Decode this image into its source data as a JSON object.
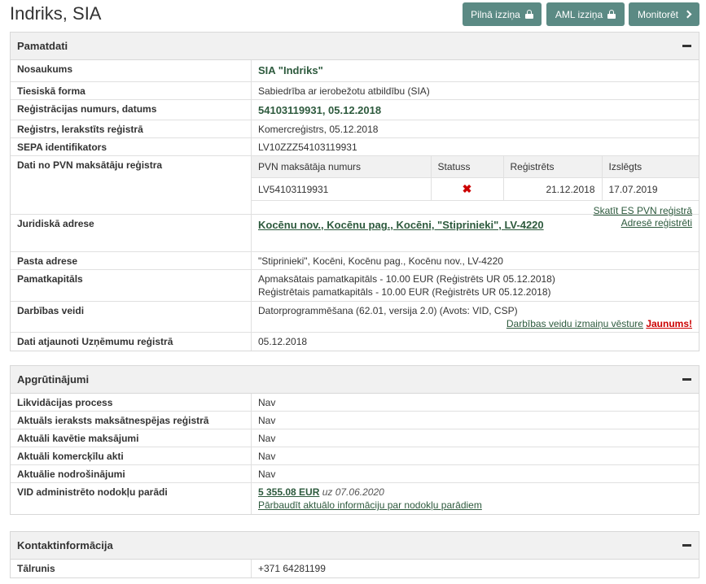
{
  "page": {
    "title": "Indriks, SIA"
  },
  "buttons": {
    "pilna": "Pilnā izziņa",
    "aml": "AML izziņa",
    "monitoret": "Monitorēt"
  },
  "pamatdati": {
    "title": "Pamatdati",
    "rows": {
      "nosaukums": {
        "label": "Nosaukums",
        "value": "SIA \"Indriks\""
      },
      "forma": {
        "label": "Tiesiskā forma",
        "value": "Sabiedrība ar ierobežotu atbildību (SIA)"
      },
      "regnr": {
        "label": "Reģistrācijas numurs, datums",
        "value": "54103119931, 05.12.2018"
      },
      "registrs": {
        "label": "Reģistrs, lerakstīts reģistrā",
        "value": "Komercreģistrs, 05.12.2018"
      },
      "sepa": {
        "label": "SEPA identifikators",
        "value": "LV10ZZZ54103119931"
      },
      "pvn": {
        "label": "Dati no PVN maksātāju reģistra",
        "headers": [
          "PVN maksātāja numurs",
          "Statuss",
          "Reģistrēts",
          "Izslēgts"
        ],
        "row": {
          "numurs": "LV54103119931",
          "registrets": "21.12.2018",
          "izslegts": "17.07.2019"
        },
        "es_link": "Skatīt ES PVN reģistrā"
      },
      "juridiska": {
        "label": "Juridiskā adrese",
        "value": "Kocēnu nov., Kocēnu pag., Kocēni, \"Stiprinieki\", LV-4220",
        "link": "Adresē reģistrēti"
      },
      "pasta": {
        "label": "Pasta adrese",
        "value": "\"Stiprinieki\", Kocēni, Kocēnu pag., Kocēnu nov., LV-4220"
      },
      "kapitals": {
        "label": "Pamatkapitāls",
        "line1": "Apmaksātais pamatkapitāls - 10.00 EUR (Reģistrēts UR 05.12.2018)",
        "line2": "Reģistrētais pamatkapitāls - 10.00 EUR (Reģistrēts UR 05.12.2018)"
      },
      "darbibas": {
        "label": "Darbības veidi",
        "value": "Datorprogrammēšana (62.01, versija 2.0) (Avots: VID, CSP)",
        "link": "Darbības veidu izmaiņu vēsture",
        "new": "Jaunums!"
      },
      "atjaunoti": {
        "label": "Dati atjaunoti Uzņēmumu reģistrā",
        "value": "05.12.2018"
      }
    }
  },
  "apgrutinajumi": {
    "title": "Apgrūtinājumi",
    "rows": [
      {
        "label": "Likvidācijas process",
        "value": "Nav"
      },
      {
        "label": "Aktuāls ieraksts maksātnespējas reģistrā",
        "value": "Nav"
      },
      {
        "label": "Aktuāli kavētie maksājumi",
        "value": "Nav"
      },
      {
        "label": "Aktuāli komercķīlu akti",
        "value": "Nav"
      },
      {
        "label": "Aktuālie nodrošinājumi",
        "value": "Nav"
      }
    ],
    "vid": {
      "label": "VID administrēto nodokļu parādi",
      "amount": "5 355.08 EUR",
      "date": "uz 07.06.2020",
      "link": "Pārbaudīt aktuālo informāciju par nodokļu parādiem"
    }
  },
  "kontakti": {
    "title": "Kontaktinformācija",
    "talrunis": {
      "label": "Tālrunis",
      "value": "+371 64281199"
    }
  }
}
